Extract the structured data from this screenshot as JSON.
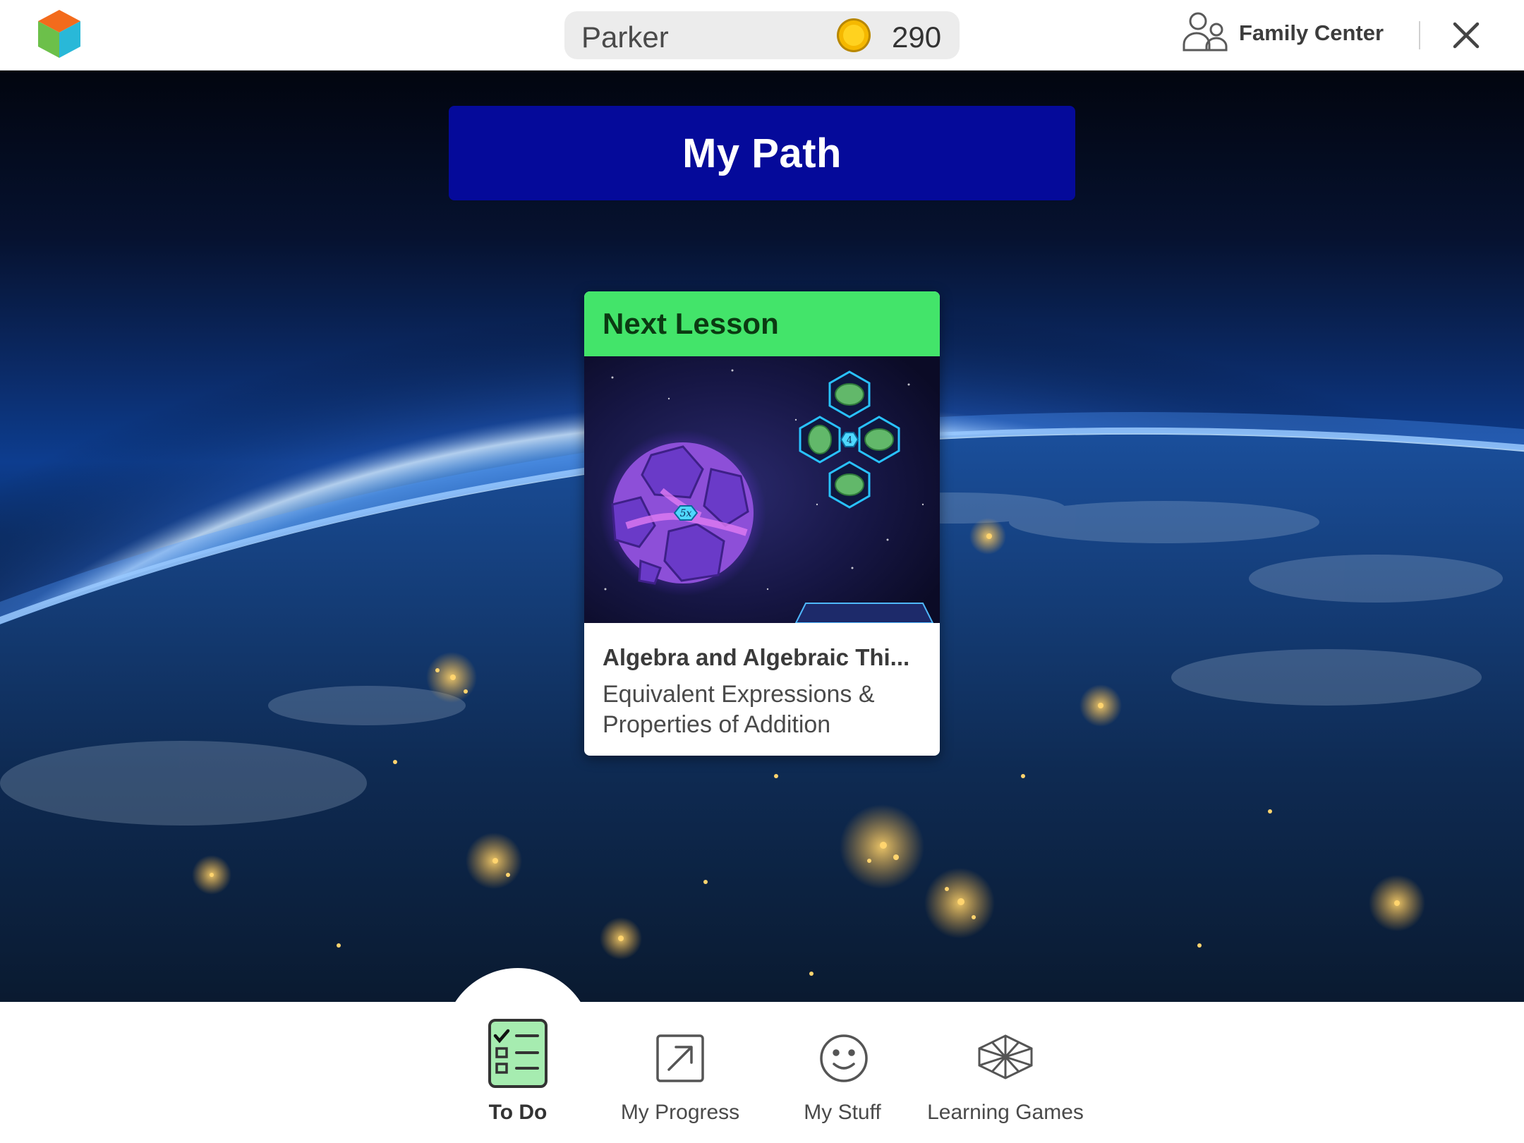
{
  "header": {
    "user_name": "Parker",
    "coin_count": "290",
    "family_center_label": "Family Center"
  },
  "banner": {
    "title": "My Path"
  },
  "lesson_card": {
    "header_label": "Next Lesson",
    "image_labels": {
      "planet_tag": "5x",
      "hex_center": "4"
    },
    "title": "Algebra and Algebraic Thi...",
    "subtitle": "Equivalent Expressions & Properties of Addition"
  },
  "bottom_nav": {
    "items": [
      {
        "label": "To Do",
        "icon": "checklist-icon",
        "active": true
      },
      {
        "label": "My Progress",
        "icon": "progress-arrow-icon",
        "active": false
      },
      {
        "label": "My Stuff",
        "icon": "smiley-icon",
        "active": false
      },
      {
        "label": "Learning Games",
        "icon": "games-cube-icon",
        "active": false
      }
    ]
  },
  "colors": {
    "banner": "#050a9a",
    "card_header": "#43e46a",
    "coin": "#f5b800"
  }
}
